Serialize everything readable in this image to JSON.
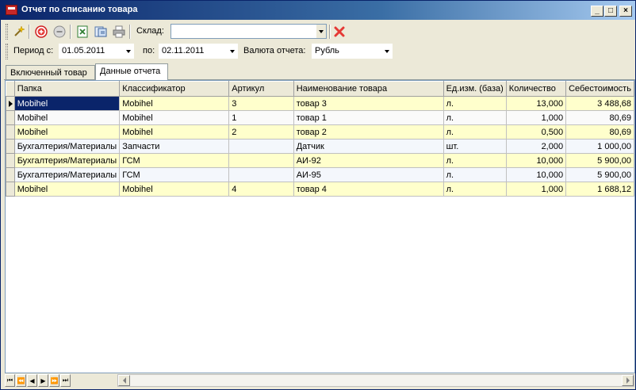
{
  "window": {
    "title": "Отчет по списанию товара",
    "controls": {
      "minimize": "_",
      "maximize": "□",
      "close": "×"
    }
  },
  "toolbar": {
    "warehouse_label": "Склад:",
    "warehouse_value": "",
    "icons": [
      "wand-icon",
      "add-icon",
      "remove-icon",
      "excel-export-icon",
      "refresh-icon",
      "print-icon",
      "clear-filter-icon"
    ]
  },
  "period": {
    "from_label": "Период с:",
    "from_value": "01.05.2011",
    "to_label": "по:",
    "to_value": "02.11.2011",
    "currency_label": "Валюта отчета:",
    "currency_value": "Рубль"
  },
  "tabs": [
    {
      "label": "Включенный товар",
      "active": false
    },
    {
      "label": "Данные отчета",
      "active": true
    }
  ],
  "grid": {
    "columns": [
      "Папка",
      "Классификатор",
      "Артикул",
      "Наименование товара",
      "Ед.изм. (база)",
      "Количество",
      "Себестоимость"
    ],
    "rows": [
      [
        "Mobihel",
        "Mobihel",
        "3",
        "товар 3",
        "л.",
        "13,000",
        "3 488,68"
      ],
      [
        "Mobihel",
        "Mobihel",
        "1",
        "товар 1",
        "л.",
        "1,000",
        "80,69"
      ],
      [
        "Mobihel",
        "Mobihel",
        "2",
        "товар 2",
        "л.",
        "0,500",
        "80,69"
      ],
      [
        "Бухгалтерия/Материалы",
        "Запчасти",
        "",
        "Датчик",
        "шт.",
        "2,000",
        "1 000,00"
      ],
      [
        "Бухгалтерия/Материалы",
        "ГСМ",
        "",
        "АИ-92",
        "л.",
        "10,000",
        "5 900,00"
      ],
      [
        "Бухгалтерия/Материалы",
        "ГСМ",
        "",
        "АИ-95",
        "л.",
        "10,000",
        "5 900,00"
      ],
      [
        "Mobihel",
        "Mobihel",
        "4",
        "товар 4",
        "л.",
        "1,000",
        "1 688,12"
      ]
    ]
  },
  "colors": {
    "row_yellow": "#ffffcc",
    "selection": "#0a246a",
    "titlebar": "#0a246a"
  }
}
